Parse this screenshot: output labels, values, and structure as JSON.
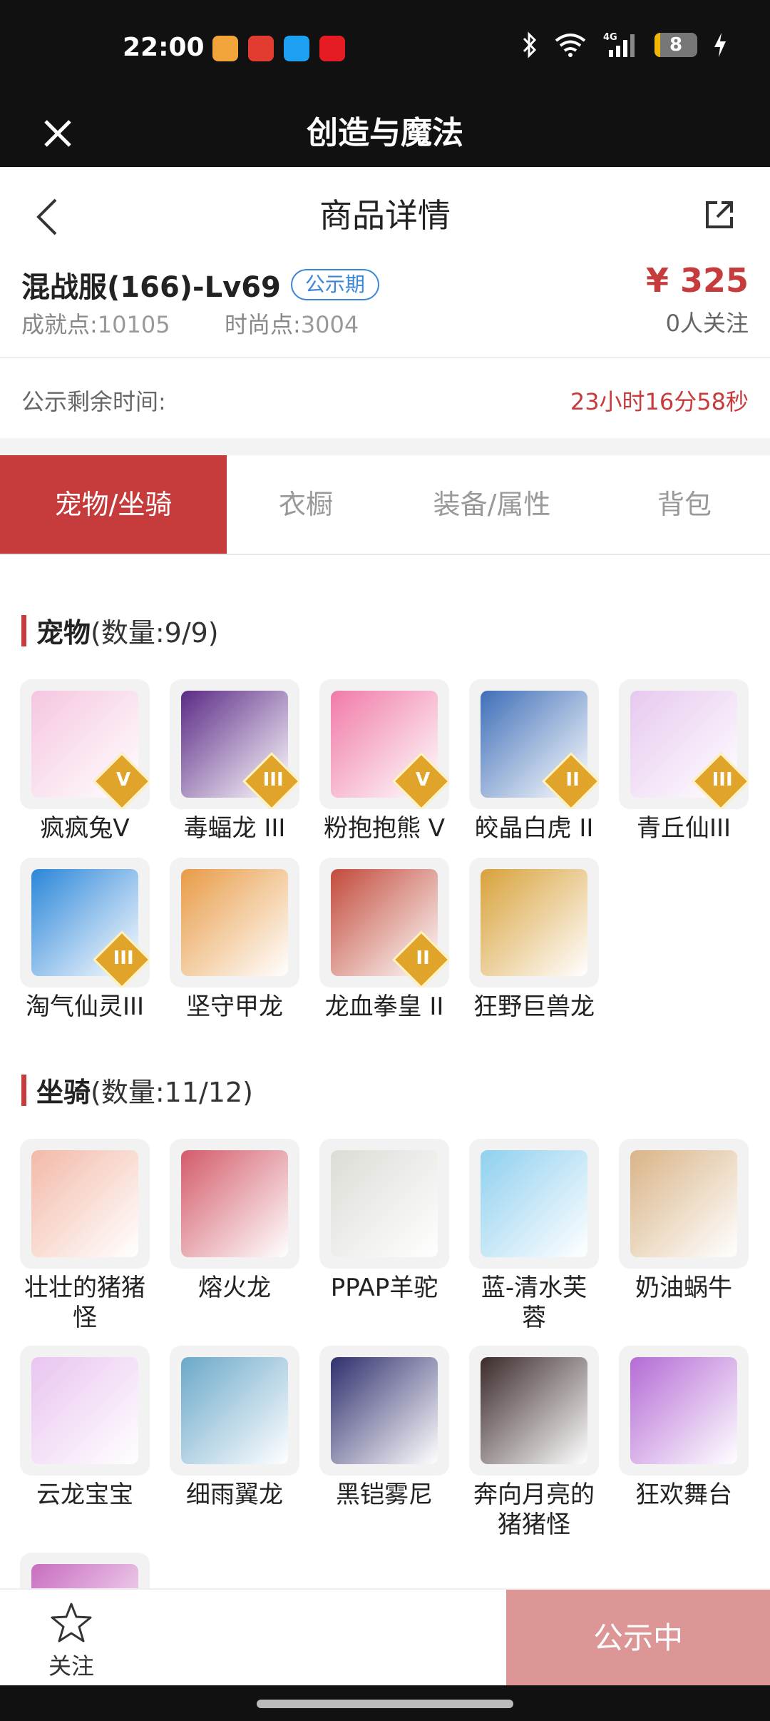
{
  "status_bar": {
    "time": "22:00",
    "battery_level": "8"
  },
  "app_bar": {
    "title": "创造与魔法"
  },
  "nav": {
    "title": "商品详情"
  },
  "product": {
    "server": "混战服(166)-Lv69",
    "badge": "公示期",
    "achievement_label": "成就点:",
    "achievement_value": "10105",
    "fashion_label": "时尚点:",
    "fashion_value": "3004",
    "price": "¥ 325",
    "followers": "0人关注"
  },
  "timer": {
    "label": "公示剩余时间:",
    "remaining": "23小时16分58秒"
  },
  "tabs": [
    {
      "label": "宠物/坐骑",
      "active": true
    },
    {
      "label": "衣橱",
      "active": false
    },
    {
      "label": "装备/属性",
      "active": false
    },
    {
      "label": "背包",
      "active": false
    }
  ],
  "pets": {
    "heading": "宠物",
    "count": "(数量:9/9)",
    "items": [
      {
        "name": "疯疯兔V",
        "tier": "V",
        "color": "#f5c6e0"
      },
      {
        "name": "毒蝠龙 III",
        "tier": "III",
        "color": "#5b2a86"
      },
      {
        "name": "粉抱抱熊 V",
        "tier": "V",
        "color": "#f07aa8"
      },
      {
        "name": "皎晶白虎 II",
        "tier": "II",
        "color": "#3f6fb8"
      },
      {
        "name": "青丘仙III",
        "tier": "III",
        "color": "#e7c8ef"
      },
      {
        "name": "淘气仙灵III",
        "tier": "III",
        "color": "#2b86d9"
      },
      {
        "name": "坚守甲龙",
        "tier": "",
        "color": "#e89b46"
      },
      {
        "name": "龙血拳皇 II",
        "tier": "II",
        "color": "#c24a3a"
      },
      {
        "name": "狂野巨兽龙",
        "tier": "",
        "color": "#d8a13a"
      }
    ]
  },
  "mounts": {
    "heading": "坐骑",
    "count": "(数量:11/12)",
    "items": [
      {
        "name": "壮壮的猪猪怪",
        "color": "#f3b9a8"
      },
      {
        "name": "熔火龙",
        "color": "#d35b6a"
      },
      {
        "name": "PPAP羊驼",
        "color": "#dcdcd6"
      },
      {
        "name": "蓝-清水芙蓉",
        "color": "#8fd0ef"
      },
      {
        "name": "奶油蜗牛",
        "color": "#d9b487"
      },
      {
        "name": "云龙宝宝",
        "color": "#e9c4f0"
      },
      {
        "name": "细雨翼龙",
        "color": "#6aa8c9"
      },
      {
        "name": "黑铠雾尼",
        "color": "#2f2f6e"
      },
      {
        "name": "奔向月亮的猪猪怪",
        "color": "#3b2a2a"
      },
      {
        "name": "狂欢舞台",
        "color": "#b46bd6"
      },
      {
        "name": "",
        "color": "#c96cc0"
      }
    ]
  },
  "bottom": {
    "follow_label": "关注",
    "action_label": "公示中"
  }
}
